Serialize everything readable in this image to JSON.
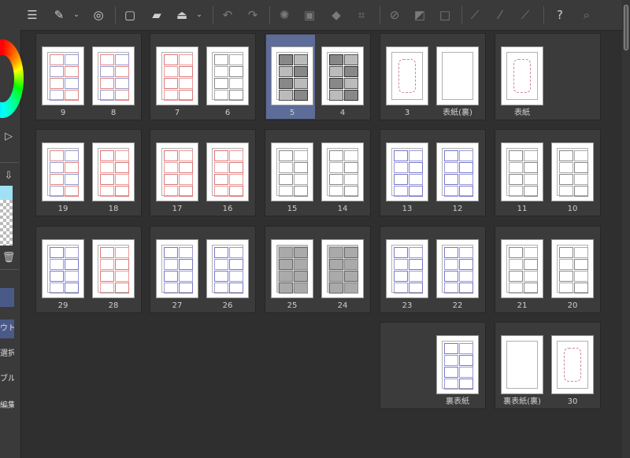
{
  "left_panel": {
    "tabs": [
      "ウト",
      "選択",
      "ブル",
      "編集"
    ]
  },
  "toolbar": {
    "buttons": [
      {
        "name": "menu-icon",
        "glyph": "☰",
        "dim": false
      },
      {
        "name": "pen-settings-icon",
        "glyph": "✎",
        "dim": false
      },
      {
        "name": "chevron-down-icon",
        "glyph": "⌄",
        "dim": false
      },
      {
        "name": "spiral-icon",
        "glyph": "◎",
        "dim": false
      },
      {
        "name": "new-page-icon",
        "glyph": "▢",
        "dim": false
      },
      {
        "name": "open-folder-icon",
        "glyph": "▰",
        "dim": false
      },
      {
        "name": "export-icon",
        "glyph": "⏏",
        "dim": false
      },
      {
        "name": "chevron-down-icon",
        "glyph": "⌄",
        "dim": false
      },
      {
        "name": "undo-icon",
        "glyph": "↶",
        "dim": true
      },
      {
        "name": "redo-icon",
        "glyph": "↷",
        "dim": true
      },
      {
        "name": "clear-icon",
        "glyph": "✺",
        "dim": true
      },
      {
        "name": "fill-icon",
        "glyph": "▣",
        "dim": true
      },
      {
        "name": "bucket-icon",
        "glyph": "◆",
        "dim": true
      },
      {
        "name": "transform-icon",
        "glyph": "⌗",
        "dim": true
      },
      {
        "name": "deselect-icon",
        "glyph": "⊘",
        "dim": true
      },
      {
        "name": "invert-selection-icon",
        "glyph": "◩",
        "dim": true
      },
      {
        "name": "select-border-icon",
        "glyph": "□",
        "dim": true
      },
      {
        "name": "line-tool-icon",
        "glyph": "⟋",
        "dim": true
      },
      {
        "name": "brush-icon",
        "glyph": "⁄",
        "dim": true
      },
      {
        "name": "pen-icon",
        "glyph": "⟋",
        "dim": true
      },
      {
        "name": "help-icon",
        "glyph": "?",
        "dim": false
      },
      {
        "name": "search-icon",
        "glyph": "⌕",
        "dim": true
      }
    ]
  },
  "spreads": [
    {
      "pages": [
        {
          "label": "9",
          "style": "mixed"
        },
        {
          "label": "8",
          "style": "mixed"
        }
      ]
    },
    {
      "pages": [
        {
          "label": "7",
          "style": "red"
        },
        {
          "label": "6",
          "style": "gray"
        }
      ]
    },
    {
      "pages": [
        {
          "label": "5",
          "style": "ink",
          "selected": true
        },
        {
          "label": "4",
          "style": "ink"
        }
      ]
    },
    {
      "pages": [
        {
          "label": "3",
          "style": "cover"
        },
        {
          "label": "表紙(裏)",
          "style": "blank"
        }
      ]
    },
    {
      "pages": [
        {
          "label": "表紙",
          "style": "cover"
        }
      ]
    },
    {
      "pages": [
        {
          "label": "19",
          "style": "mixed"
        },
        {
          "label": "18",
          "style": "red"
        }
      ]
    },
    {
      "pages": [
        {
          "label": "17",
          "style": "red"
        },
        {
          "label": "16",
          "style": "red"
        }
      ]
    },
    {
      "pages": [
        {
          "label": "15",
          "style": "gray"
        },
        {
          "label": "14",
          "style": "gray"
        }
      ]
    },
    {
      "pages": [
        {
          "label": "13",
          "style": "blue"
        },
        {
          "label": "12",
          "style": "blue"
        }
      ]
    },
    {
      "pages": [
        {
          "label": "11",
          "style": "gray"
        },
        {
          "label": "10",
          "style": "gray"
        }
      ]
    },
    {
      "pages": [
        {
          "label": "29",
          "style": "blue"
        },
        {
          "label": "28",
          "style": "red"
        }
      ]
    },
    {
      "pages": [
        {
          "label": "27",
          "style": "blue"
        },
        {
          "label": "26",
          "style": "blue"
        }
      ]
    },
    {
      "pages": [
        {
          "label": "25",
          "style": "tone"
        },
        {
          "label": "24",
          "style": "tone"
        }
      ]
    },
    {
      "pages": [
        {
          "label": "23",
          "style": "blue"
        },
        {
          "label": "22",
          "style": "blue"
        }
      ]
    },
    {
      "pages": [
        {
          "label": "21",
          "style": "gray"
        },
        {
          "label": "20",
          "style": "gray"
        }
      ]
    },
    {
      "pages": [
        {
          "label": "裏表紙",
          "style": "blue"
        }
      ]
    },
    {
      "pages": [
        {
          "label": "裏表紙(裏)",
          "style": "blank"
        },
        {
          "label": "30",
          "style": "cover"
        }
      ]
    }
  ]
}
